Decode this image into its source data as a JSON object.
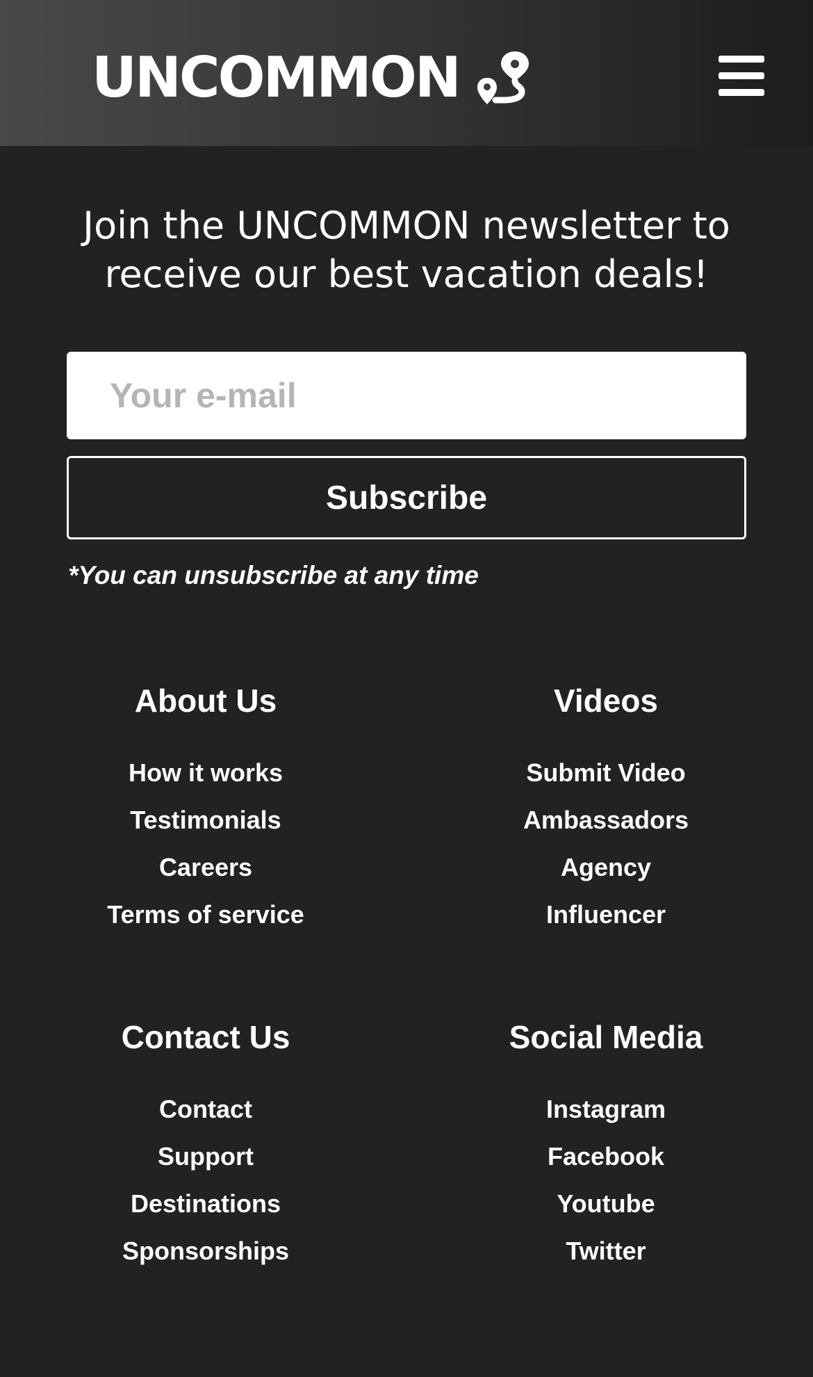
{
  "header": {
    "brand": "UNCOMMON",
    "brand_icon": "route-pin-icon",
    "menu_icon": "hamburger-menu-icon"
  },
  "newsletter": {
    "heading": "Join the UNCOMMON newsletter to receive our best vacation deals!",
    "email_placeholder": "Your e-mail",
    "email_value": "",
    "subscribe_label": "Subscribe",
    "note": "*You can unsubscribe at any time"
  },
  "footer": {
    "about": {
      "heading": "About Us",
      "links": [
        "How it works",
        "Testimonials",
        "Careers",
        "Terms of service"
      ]
    },
    "videos": {
      "heading": "Videos",
      "links": [
        "Submit Video",
        "Ambassadors",
        "Agency",
        "Influencer"
      ]
    },
    "contact": {
      "heading": "Contact Us",
      "links": [
        "Contact",
        "Support",
        "Destinations",
        "Sponsorships"
      ]
    },
    "social": {
      "heading": "Social Media",
      "links": [
        "Instagram",
        "Facebook",
        "Youtube",
        "Twitter"
      ]
    }
  },
  "colors": {
    "background": "#222222",
    "header_gradient_start": "#48494b",
    "header_gradient_end": "#1d1d1e",
    "text": "#ffffff",
    "placeholder": "#b5b5b5"
  }
}
